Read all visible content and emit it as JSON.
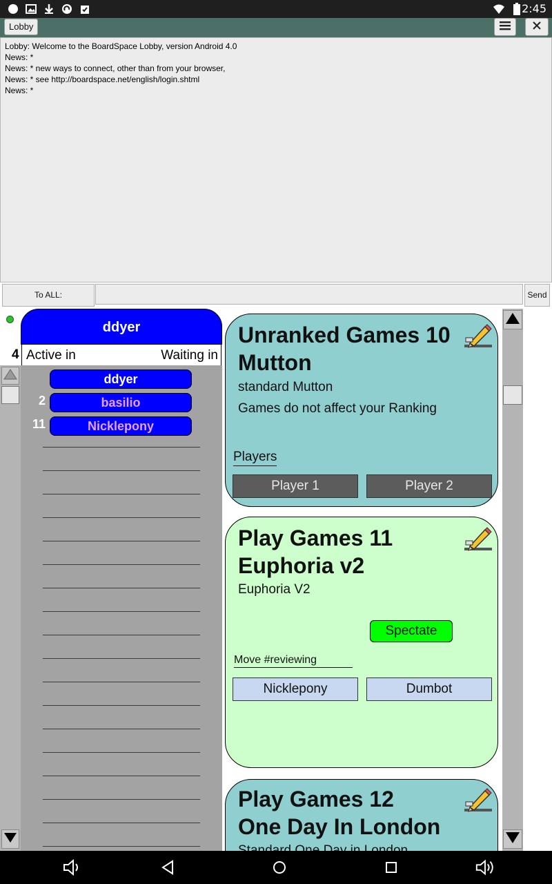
{
  "status_bar": {
    "time": "2:45",
    "icons": [
      "circle-icon",
      "image-icon",
      "download-icon",
      "sync-icon",
      "clipboard-check-icon",
      "wifi-icon",
      "battery-icon"
    ]
  },
  "title_bar": {
    "lobby_button": "Lobby",
    "menu_icon": "hamburger-menu-icon",
    "close_icon": "close-icon"
  },
  "chat": {
    "lines": [
      "Lobby: Welcome to the BoardSpace Lobby, version Android 4.0",
      "News: *",
      "News: * new ways to connect, other than from your browser,",
      "News: * see http://boardspace.net/english/login.shtml",
      "News: *"
    ],
    "to_all_button": "To ALL:",
    "input_value": "",
    "send_button": "Send"
  },
  "users": {
    "current_user": "ddyer",
    "total_count": "4",
    "active_label": "Active in",
    "waiting_label": "Waiting in",
    "list": [
      {
        "number": "",
        "name": "ddyer",
        "color": "#ffffff"
      },
      {
        "number": "2",
        "name": "basilio",
        "color": "#e8a0ff"
      },
      {
        "number": "11",
        "name": "Nicklepony",
        "color": "#e8a0ff"
      }
    ]
  },
  "games": [
    {
      "title_line1": "Unranked Games 10",
      "title_line2": "Mutton",
      "subtitle": "standard Mutton",
      "note": "Games do not affect your Ranking",
      "players_label": "Players",
      "slot1": "Player 1",
      "slot2": "Player 2",
      "background": "#8fcfcf"
    },
    {
      "title_line1": "Play Games 11",
      "title_line2": "Euphoria v2",
      "subtitle": "Euphoria V2",
      "spectate_button": "Spectate",
      "move_label": "Move #reviewing",
      "slot1": "Nicklepony",
      "slot2": "Dumbot",
      "background": "#ccffcc"
    },
    {
      "title_line1": "Play Games 12",
      "title_line2": "One Day In London",
      "subtitle": "Standard One Day in London",
      "background": "#8fcfcf"
    }
  ],
  "nav_bar": {
    "icons": [
      "volume-down-icon",
      "back-icon",
      "home-icon",
      "recents-icon",
      "volume-up-icon"
    ]
  }
}
